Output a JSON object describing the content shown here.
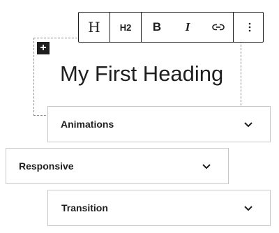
{
  "block": {
    "heading_text": "My First Heading",
    "inserter_symbol": "+",
    "inserter_icon": "plus-icon"
  },
  "toolbar": {
    "block_type_symbol": "H",
    "block_type_icon": "heading-icon",
    "level_label": "H2",
    "bold_label": "B",
    "italic_label": "I",
    "link_icon": "link-icon",
    "more_icon": "more-vertical-icon"
  },
  "panels": [
    {
      "label": "Animations",
      "icon": "chevron-down-icon"
    },
    {
      "label": "Responsive",
      "icon": "chevron-down-icon"
    },
    {
      "label": "Transition",
      "icon": "chevron-down-icon"
    }
  ],
  "colors": {
    "text": "#1e1e1e",
    "panel_border": "#c7c7c7",
    "outline_dashed": "#8c8c8c",
    "background": "#ffffff"
  }
}
